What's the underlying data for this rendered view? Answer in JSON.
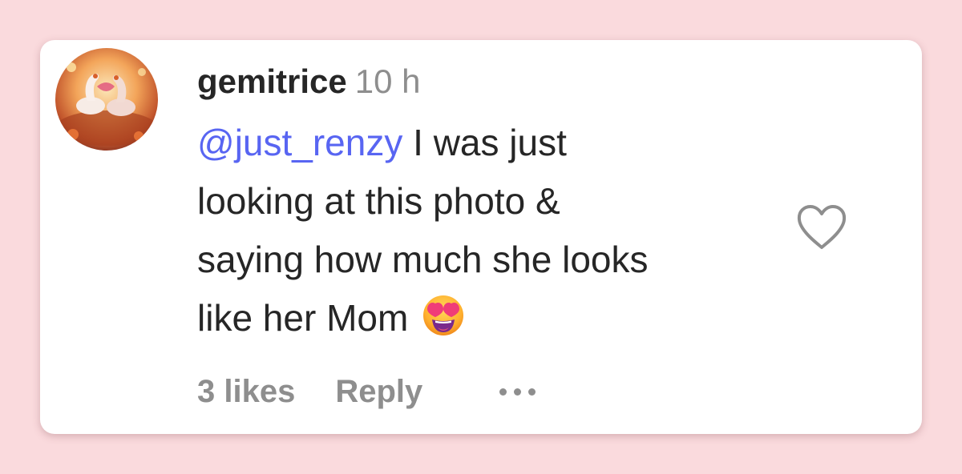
{
  "comment": {
    "username": "gemitrice",
    "time": "10 h",
    "mention": "@just_renzy",
    "text_line1": " I was just",
    "text_line2": "looking at this photo &",
    "text_line3": "saying how much she looks",
    "text_line4": "like her Mom",
    "emoji": "smiling-face-with-heart-eyes"
  },
  "actions": {
    "likes": "3 likes",
    "reply": "Reply"
  },
  "icons": {
    "like": "heart-icon",
    "more": "more-options-icon"
  },
  "colors": {
    "page_background": "#fadadd",
    "card_background": "#ffffff",
    "mention": "#5865f2",
    "text": "#262626",
    "secondary": "#8e8e8e"
  }
}
